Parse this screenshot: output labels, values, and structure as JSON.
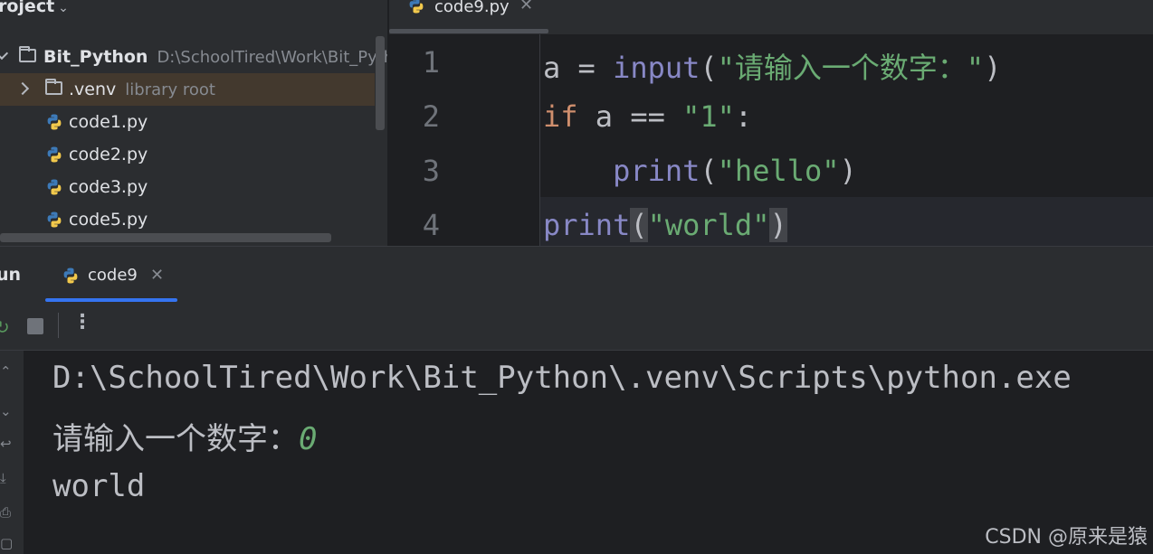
{
  "project": {
    "title": "roject",
    "items": [
      {
        "name": "Bit_Python",
        "hint": "D:\\SchoolTired\\Work\\Bit_Pythor"
      },
      {
        "name": ".venv",
        "hint": "library root"
      },
      {
        "name": "code1.py"
      },
      {
        "name": "code2.py"
      },
      {
        "name": "code3.py"
      },
      {
        "name": "code5.py"
      }
    ]
  },
  "editor": {
    "tab": {
      "label": "code9.py",
      "close": "✕"
    },
    "line_numbers": [
      "1",
      "2",
      "3",
      "4"
    ],
    "code": {
      "l1": {
        "var": "a",
        "op": " = ",
        "fn": "input",
        "open": "(",
        "str": "\"请输入一个数字：\"",
        "close": ")"
      },
      "l2": {
        "kw": "if",
        "rest": " a == ",
        "str": "\"1\"",
        "colon": ":"
      },
      "l3": {
        "indent": "    ",
        "fn": "print",
        "open": "(",
        "str": "\"hello\"",
        "close": ")"
      },
      "l4": {
        "fn": "print",
        "open": "(",
        "str": "\"world\"",
        "close": ")"
      }
    }
  },
  "run": {
    "title": "un",
    "tab": {
      "label": "code9",
      "close": "✕"
    },
    "more": "⋮",
    "console": {
      "line1": "D:\\SchoolTired\\Work\\Bit_Python\\.venv\\Scripts\\python.exe",
      "prompt": "请输入一个数字：",
      "input": "0",
      "line3": "world"
    }
  },
  "watermark": "CSDN @原来是猿",
  "colors": {
    "background": "#1e1f22",
    "panel": "#2b2d30",
    "keyword": "#cf8e6d",
    "function": "#8888c6",
    "string": "#6aab73",
    "accent": "#3574f0"
  }
}
